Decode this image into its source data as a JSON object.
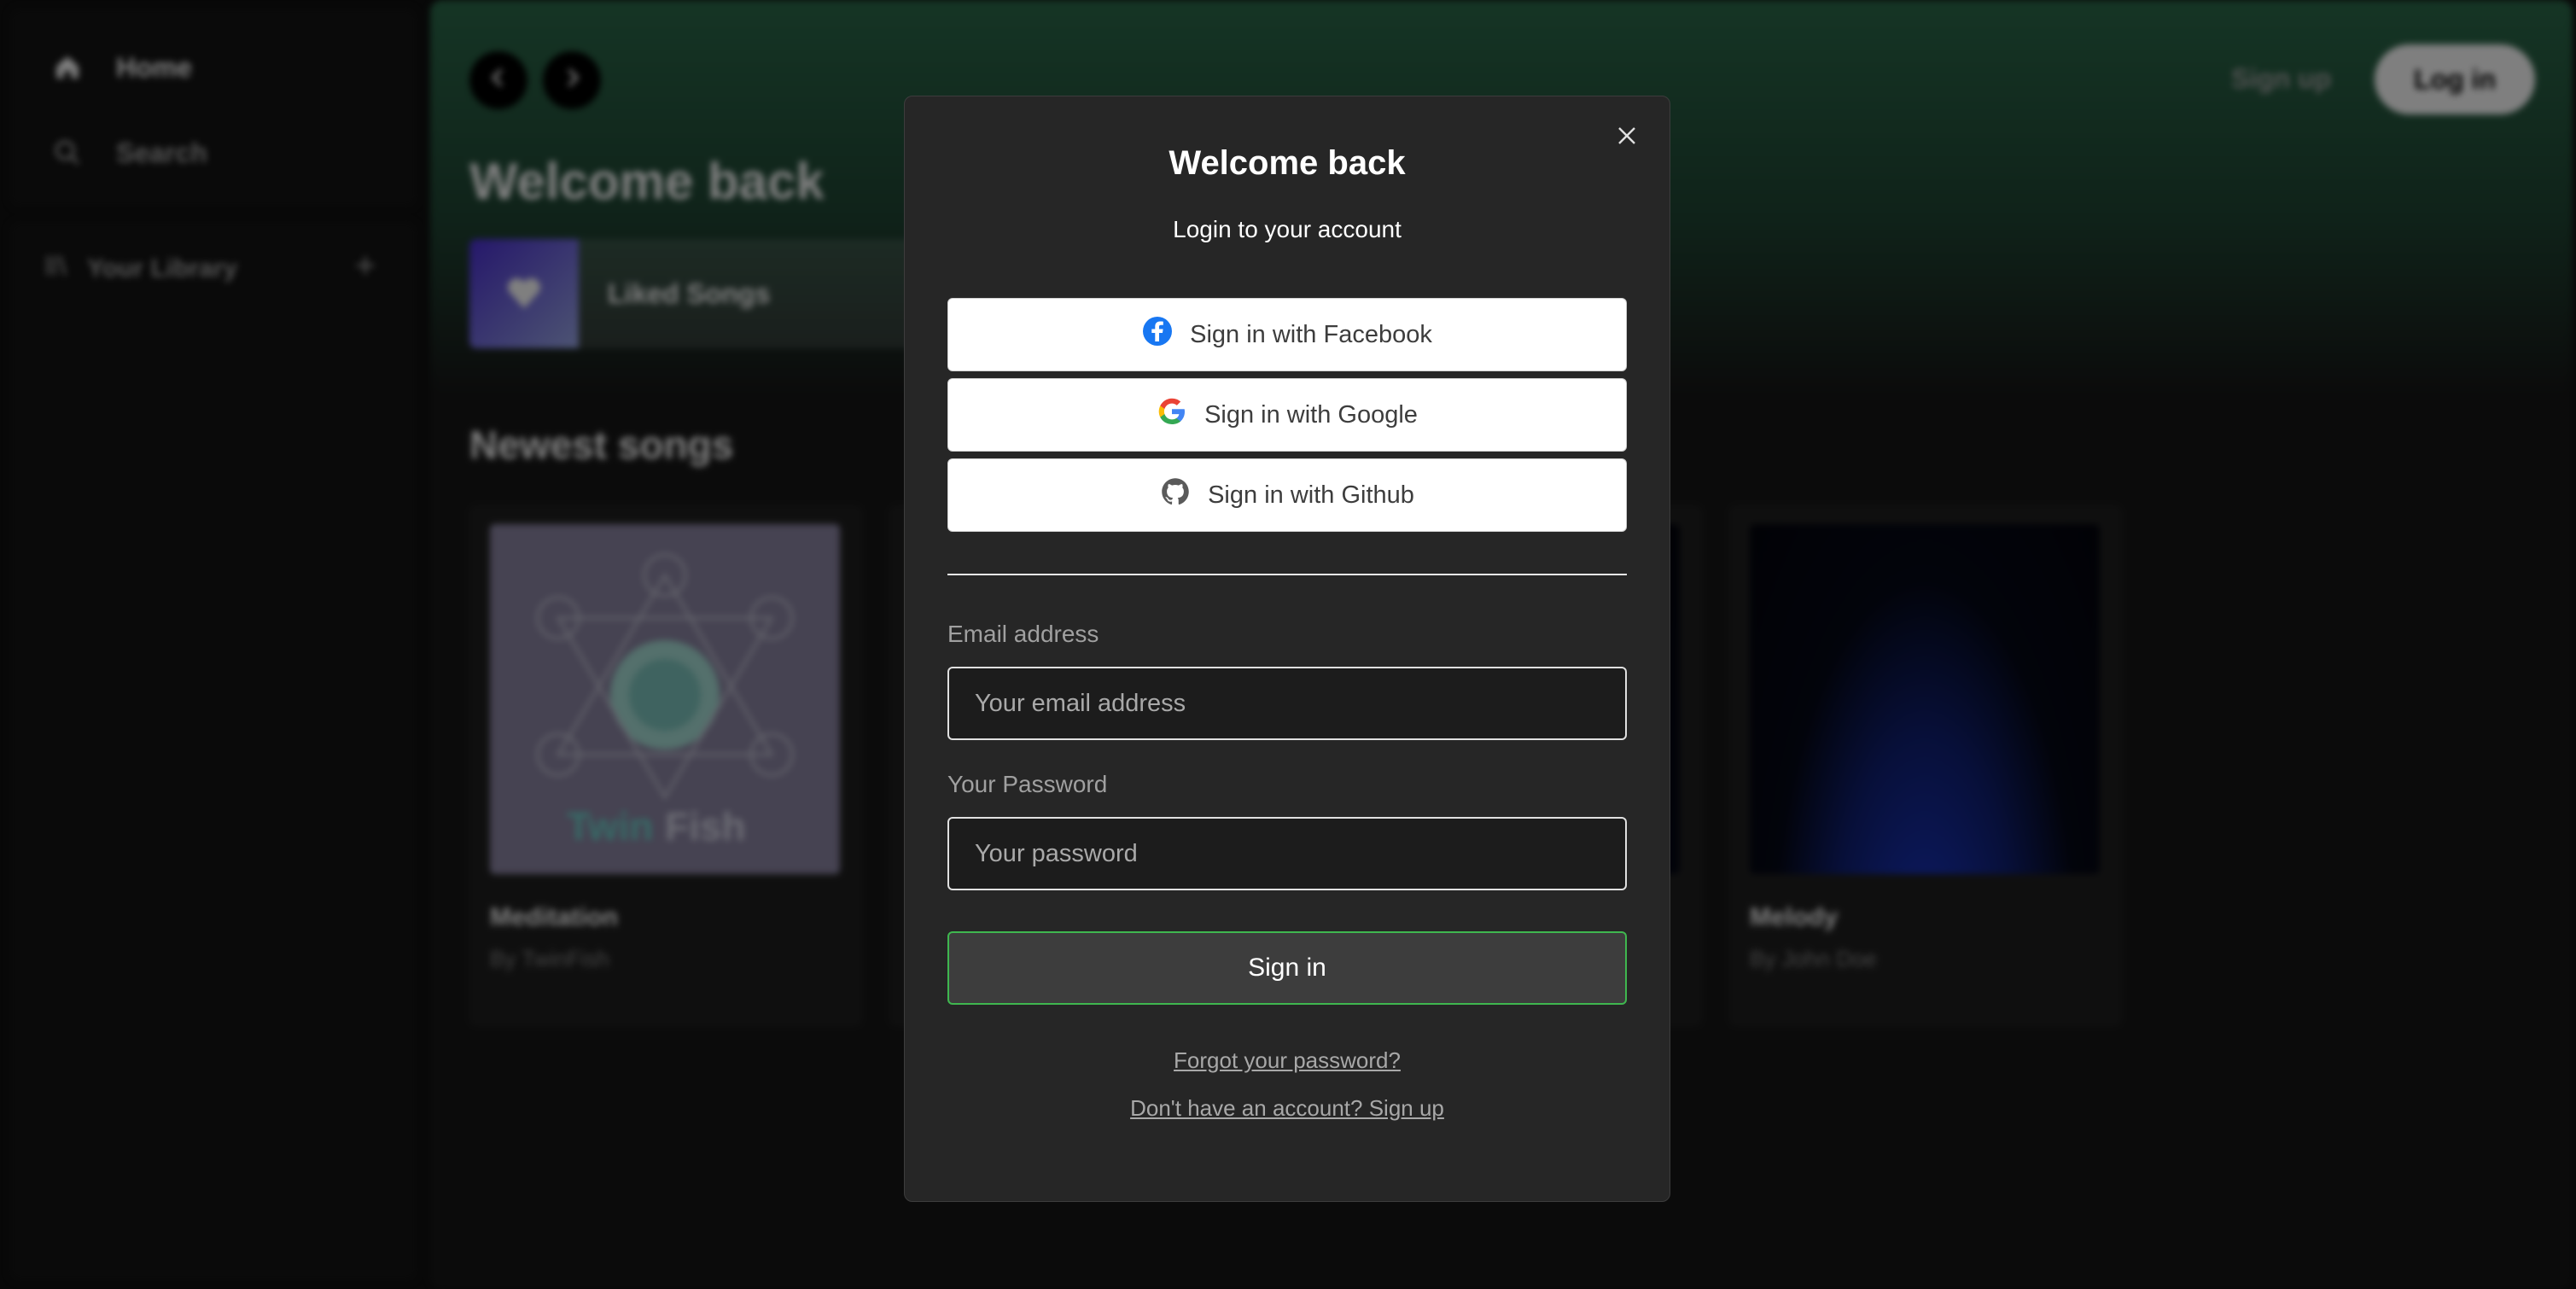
{
  "sidebar": {
    "nav": [
      {
        "label": "Home",
        "icon": "home-icon"
      },
      {
        "label": "Search",
        "icon": "search-icon"
      }
    ],
    "library": {
      "label": "Your Library",
      "icon": "library-icon",
      "add_icon": "plus-icon"
    }
  },
  "header": {
    "back_icon": "chevron-left-icon",
    "forward_icon": "chevron-right-icon",
    "signup_label": "Sign up",
    "login_label": "Log in"
  },
  "main": {
    "title": "Welcome back",
    "liked": {
      "label": "Liked Songs",
      "icon": "heart-icon"
    },
    "section_title": "Newest songs",
    "songs": [
      {
        "title": "Meditation",
        "artist": "By TwinFish",
        "art_text_a": "Twin",
        "art_text_b": "Fish"
      },
      {
        "title": "",
        "artist": ""
      },
      {
        "title": "",
        "artist": ""
      },
      {
        "title": "Melody",
        "artist": "By John Doe"
      }
    ]
  },
  "modal": {
    "close_icon": "close-icon",
    "title": "Welcome back",
    "subtitle": "Login to your account",
    "providers": [
      {
        "label": "Sign in with Facebook",
        "icon": "facebook-icon"
      },
      {
        "label": "Sign in with Google",
        "icon": "google-icon"
      },
      {
        "label": "Sign in with Github",
        "icon": "github-icon"
      }
    ],
    "email": {
      "label": "Email address",
      "placeholder": "Your email address",
      "value": ""
    },
    "password": {
      "label": "Your Password",
      "placeholder": "Your password",
      "value": ""
    },
    "submit_label": "Sign in",
    "forgot_link": "Forgot your password?",
    "signup_link": "Don't have an account? Sign up"
  },
  "colors": {
    "accent_green": "#3fb74f",
    "header_gradient_top": "#2b6a4a",
    "modal_bg": "#262626",
    "facebook_blue": "#1877f2"
  }
}
